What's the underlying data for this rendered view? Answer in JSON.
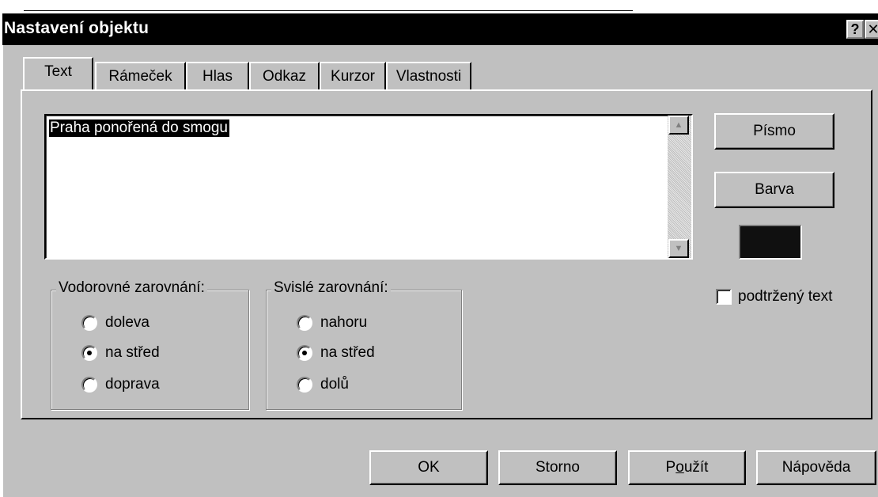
{
  "window": {
    "title": "Nastavení objektu",
    "help_glyph": "?",
    "close_glyph": "✕"
  },
  "tabs": [
    {
      "label": "Text",
      "active": true
    },
    {
      "label": "Rámeček",
      "active": false
    },
    {
      "label": "Hlas",
      "active": false
    },
    {
      "label": "Odkaz",
      "active": false
    },
    {
      "label": "Kurzor",
      "active": false
    },
    {
      "label": "Vlastnosti",
      "active": false
    }
  ],
  "text_field": {
    "value": "Praha ponořená do smogu"
  },
  "scrollbar": {
    "up_glyph": "▲",
    "down_glyph": "▼"
  },
  "side_buttons": {
    "font_label": "Písmo",
    "color_label": "Barva"
  },
  "color": {
    "current": "#101010"
  },
  "underline": {
    "label": "podtržený text",
    "checked": false
  },
  "horizontal_alignment": {
    "legend": "Vodorovné zarovnání:",
    "options": [
      {
        "label": "doleva",
        "checked": false
      },
      {
        "label": "na střed",
        "checked": true
      },
      {
        "label": "doprava",
        "checked": false
      }
    ]
  },
  "vertical_alignment": {
    "legend": "Svislé zarovnání:",
    "options": [
      {
        "label": "nahoru",
        "checked": false
      },
      {
        "label": "na střed",
        "checked": true
      },
      {
        "label": "dolů",
        "checked": false
      }
    ]
  },
  "footer": {
    "ok_label": "OK",
    "cancel_label": "Storno",
    "apply_prefix": "P",
    "apply_mnemonic": "o",
    "apply_suffix": "užít",
    "help_label": "Nápověda"
  }
}
